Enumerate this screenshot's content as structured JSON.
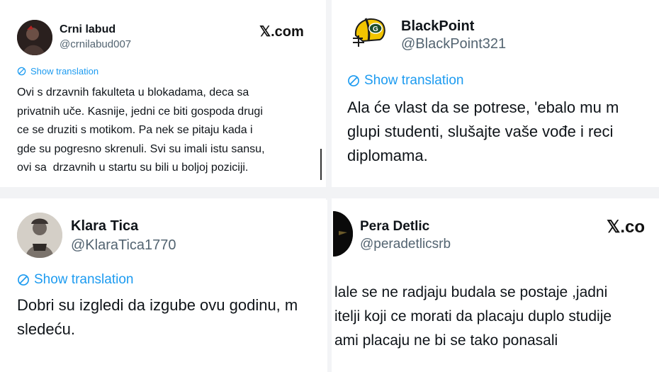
{
  "tweets": [
    {
      "name": "Crni labud",
      "handle": "@crnilabud007",
      "source": "𝕏.com",
      "translate": "Show translation",
      "text": "Ovi s drzavnih fakulteta u blokadama, deca sa\nprivatnih uče. Kasnije, jedni ce biti gospoda drugi\nce se druziti s motikom. Pa nek se pitaju kada i\ngde su pogresno skrenuli. Svi su imali istu sansu,\novi sa  drzavnih u startu su bili u boljoj poziciji."
    },
    {
      "name": "BlackPoint",
      "handle": "@BlackPoint321",
      "translate": "Show translation",
      "text": "Ala će vlast da se potrese, 'ebalo mu m\nglupi studenti, slušajte vaše vođe i reci\ndiplomama."
    },
    {
      "name": "Klara Tica",
      "handle": "@KlaraTica1770",
      "translate": "Show translation",
      "text": "Dobri su izgledi da izgube ovu godinu, m\nsledeću."
    },
    {
      "name": "Pera Detlic",
      "handle": "@peradetlicsrb",
      "source": "𝕏.co",
      "text": "lale se ne radjaju budala se postaje ,jadni\nitelji koji ce morati da placaju duplo studije\nami placaju ne bi se tako ponasali"
    }
  ],
  "colors": {
    "link": "#1d9bf0",
    "handle": "#536471",
    "text": "#0f1419"
  },
  "icons": {
    "translate": "translate-icon",
    "avatar_blackpoint": "green-bay-helmet-icon"
  }
}
